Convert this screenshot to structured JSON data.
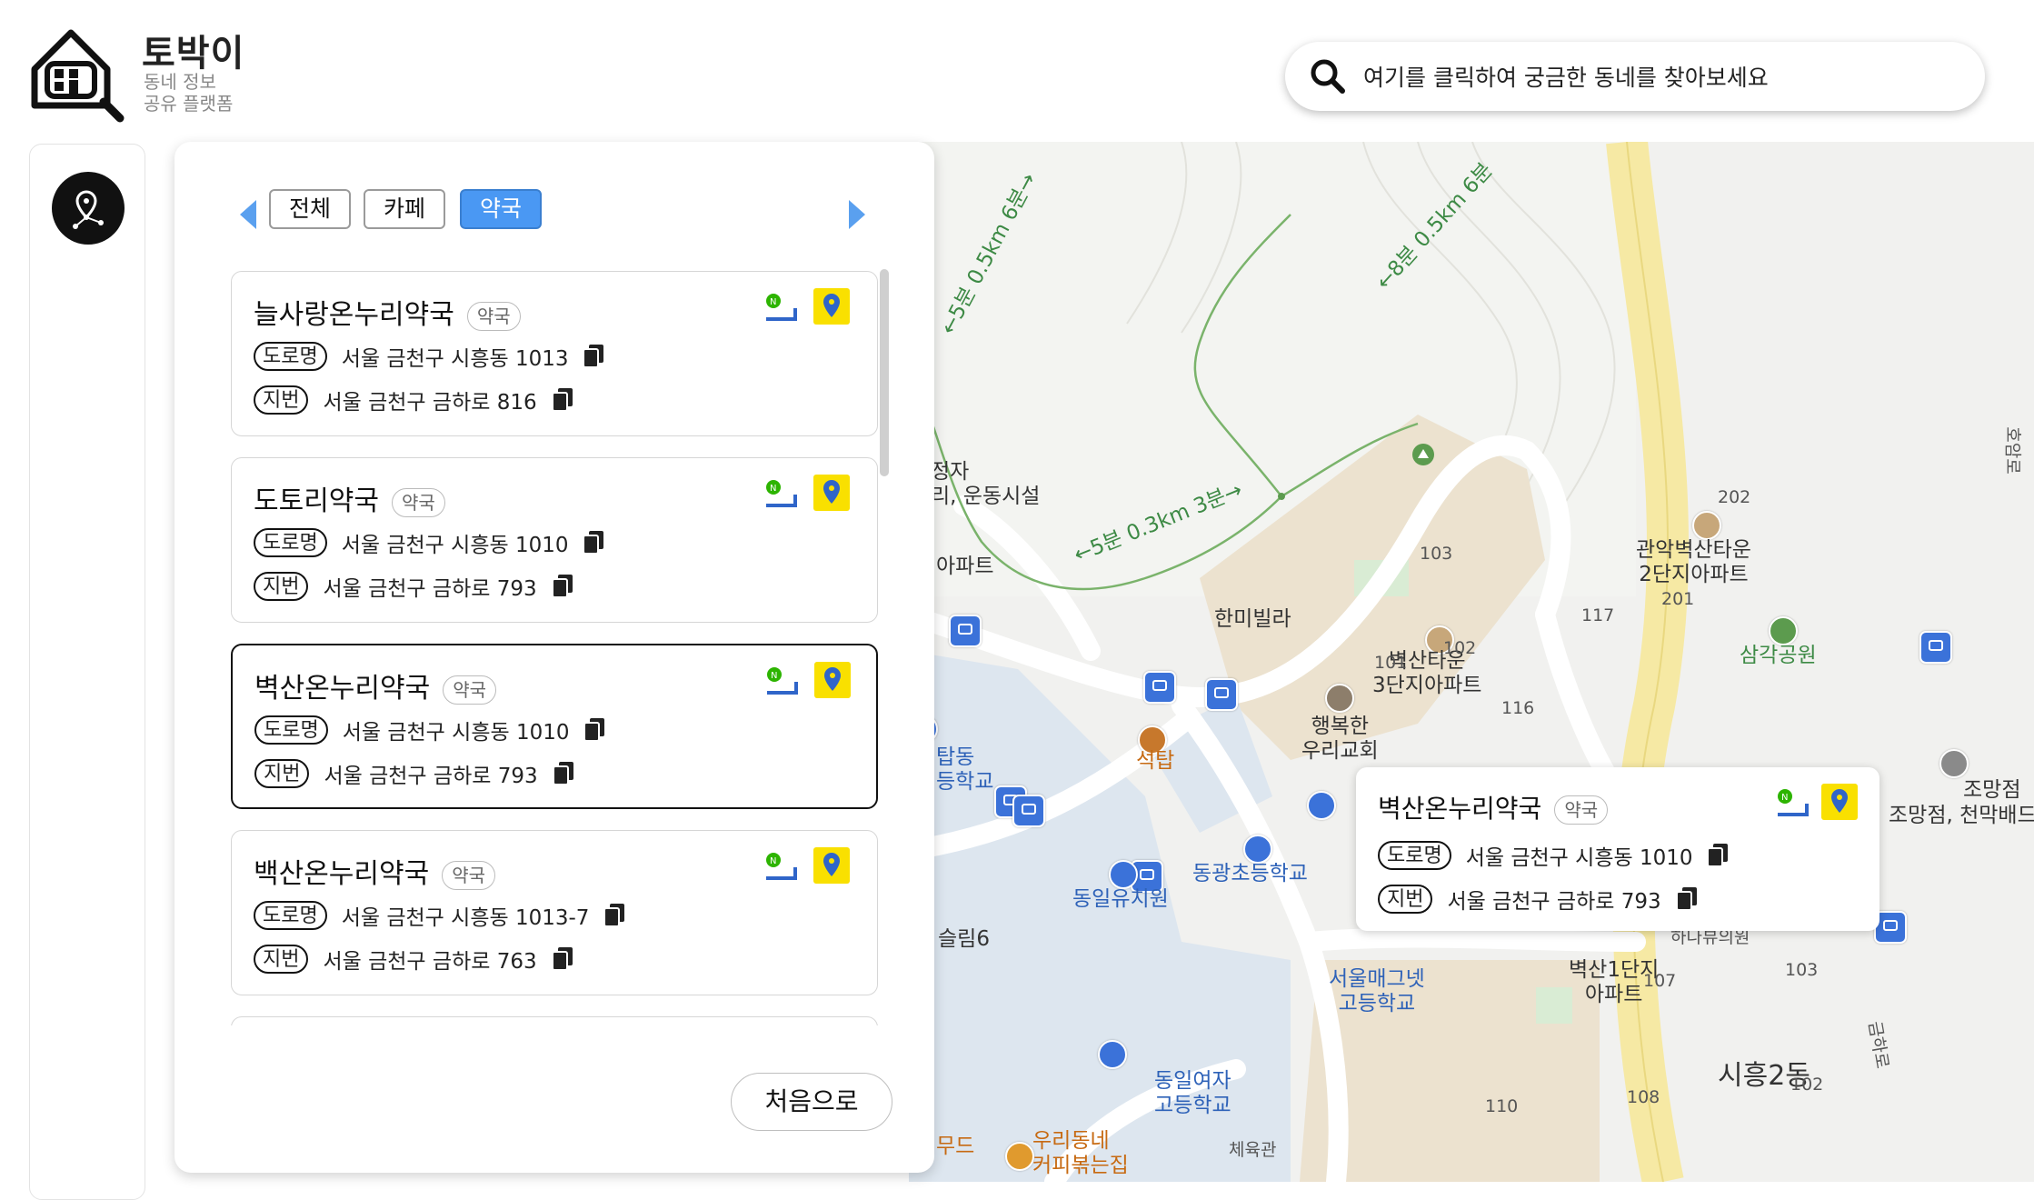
{
  "app": {
    "title": "토박이",
    "subtitle_line1": "동네 정보",
    "subtitle_line2": "공유 플랫폼",
    "logo_icon": "house-search-logo"
  },
  "search": {
    "placeholder": "여기를 클릭하여 궁금한 동네를 찾아보세요",
    "icon": "search-icon"
  },
  "rail": {
    "icon": "map-pin-network-icon"
  },
  "filters": {
    "tabs": [
      {
        "label": "전체",
        "active": false
      },
      {
        "label": "카페",
        "active": false
      },
      {
        "label": "약국",
        "active": true
      }
    ]
  },
  "labels": {
    "road": "도로명",
    "lot": "지번"
  },
  "places": [
    {
      "name": "늘사랑온누리약국",
      "category": "약국",
      "road_address": "서울 금천구 시흥동 1013",
      "lot_address": "서울 금천구 금하로 816",
      "selected": false
    },
    {
      "name": "도토리약국",
      "category": "약국",
      "road_address": "서울 금천구 시흥동 1010",
      "lot_address": "서울 금천구 금하로 793",
      "selected": false
    },
    {
      "name": "벽산온누리약국",
      "category": "약국",
      "road_address": "서울 금천구 시흥동 1010",
      "lot_address": "서울 금천구 금하로 793",
      "selected": true
    },
    {
      "name": "백산온누리약국",
      "category": "약국",
      "road_address": "서울 금천구 시흥동 1013-7",
      "lot_address": "서울 금천구 금하로 763",
      "selected": false
    }
  ],
  "first_button": "처음으로",
  "popup": {
    "name": "벽산온누리약국",
    "category": "약국",
    "road_address": "서울 금천구 시흥동 1010",
    "lot_address": "서울 금천구 금하로 793"
  },
  "map_labels": {
    "trail1": "←5분 0.3km 3분→",
    "trail2": "←8분 0.5km 6분",
    "trail3": "←5분 0.5km 6분→",
    "hanmi": "한미빌라",
    "apt3": "벽산타운\n3단지아파트",
    "apt2": "관악벽산타운\n2단지아파트",
    "church": "행복한\n우리교회",
    "seoktap": "석탑",
    "samgak": "삼각공원",
    "donggwang": "동광초등학교",
    "dongil_kinder": "동일유치원",
    "magnet": "서울매그넷\n고등학교",
    "dongil_girls": "동일여자\n고등학교",
    "cafe": "우리동네\n커피볶는집",
    "gym": "체육관",
    "apt1": "벽산1단지\n아파트",
    "siheung2": "시흥2동",
    "jomang": "조망점, 천막배드",
    "jomang2": "조망점",
    "geumharo": "금하로",
    "homamro": "호암로",
    "n101": "101",
    "n102a": "102",
    "n103a": "103",
    "n116": "116",
    "n117": "117",
    "n201": "201",
    "n202": "202",
    "n103b": "103",
    "n102b": "102",
    "n107": "107",
    "n108": "108",
    "n110": "110",
    "left1": "정자\n리, 운동시설",
    "left2": "아파트",
    "left3": "탑동\n등학교",
    "left4": "슬림6",
    "left5": "무드",
    "hanaview": "하나뷰의원"
  },
  "colors": {
    "accent": "#4a98f3",
    "kakao_yellow": "#f9e000",
    "naver_green": "#2db400",
    "map_bus": "#3b72d9"
  }
}
